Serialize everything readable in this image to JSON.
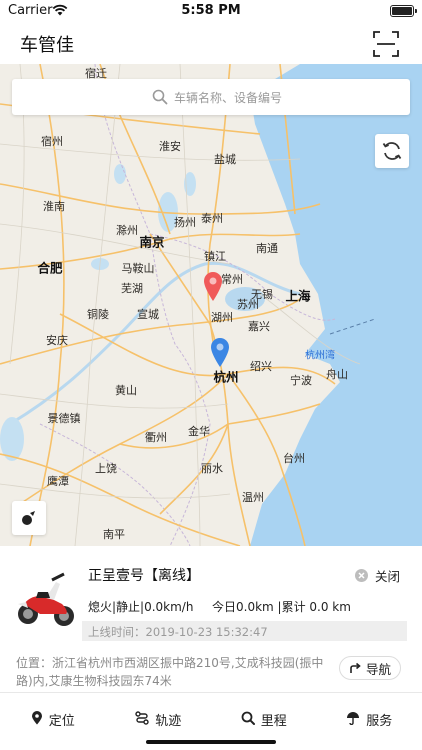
{
  "status_bar": {
    "carrier": "Carrier",
    "time": "5:58 PM"
  },
  "header": {
    "title": "车管佳",
    "scan_icon": "scan-frame-icon"
  },
  "search": {
    "placeholder": "车辆名称、设备编号",
    "icon": "search-icon"
  },
  "map": {
    "refresh_icon": "refresh-icon",
    "locate_icon": "compass-icon",
    "cities": [
      {
        "name": "宿迁",
        "major": false
      },
      {
        "name": "宿州",
        "major": false
      },
      {
        "name": "淮安",
        "major": false
      },
      {
        "name": "盐城",
        "major": false
      },
      {
        "name": "淮南",
        "major": false
      },
      {
        "name": "滁州",
        "major": false
      },
      {
        "name": "扬州",
        "major": false
      },
      {
        "name": "泰州",
        "major": false
      },
      {
        "name": "南京",
        "major": true
      },
      {
        "name": "镇江",
        "major": false
      },
      {
        "name": "南通",
        "major": false
      },
      {
        "name": "合肥",
        "major": true
      },
      {
        "name": "马鞍山",
        "major": false
      },
      {
        "name": "常州",
        "major": false
      },
      {
        "name": "芜湖",
        "major": false
      },
      {
        "name": "无锡",
        "major": false
      },
      {
        "name": "苏州",
        "major": false
      },
      {
        "name": "上海",
        "major": true
      },
      {
        "name": "铜陵",
        "major": false
      },
      {
        "name": "宣城",
        "major": false
      },
      {
        "name": "湖州",
        "major": false
      },
      {
        "name": "嘉兴",
        "major": false
      },
      {
        "name": "安庆",
        "major": false
      },
      {
        "name": "杭州湾",
        "major": false
      },
      {
        "name": "杭州",
        "major": true
      },
      {
        "name": "舟山",
        "major": false
      },
      {
        "name": "黄山",
        "major": false
      },
      {
        "name": "绍兴",
        "major": false
      },
      {
        "name": "宁波",
        "major": false
      },
      {
        "name": "景德镇",
        "major": false
      },
      {
        "name": "衢州",
        "major": false
      },
      {
        "name": "金华",
        "major": false
      },
      {
        "name": "台州",
        "major": false
      },
      {
        "name": "上饶",
        "major": false
      },
      {
        "name": "丽水",
        "major": false
      },
      {
        "name": "鹰潭",
        "major": false
      },
      {
        "name": "温州",
        "major": false
      },
      {
        "name": "南平",
        "major": false
      }
    ],
    "markers": [
      {
        "type": "red-pin"
      },
      {
        "type": "blue-pin"
      }
    ]
  },
  "vehicle": {
    "name": "正呈壹号【离线】",
    "close_label": "关闭",
    "status": "熄火|静止|0.0km/h",
    "mileage": "今日0.0km |累计 0.0 km",
    "online_time": "上线时间：2019-10-23 15:32:47",
    "address": "位置：浙江省杭州市西湖区振中路210号,艾成科技园(振中路)内,艾康生物科技园东74米",
    "navigate_label": "导航"
  },
  "tabs": [
    {
      "label": "定位",
      "icon": "location-pin-icon"
    },
    {
      "label": "轨迹",
      "icon": "track-route-icon"
    },
    {
      "label": "里程",
      "icon": "search-icon"
    },
    {
      "label": "服务",
      "icon": "umbrella-icon"
    }
  ],
  "colors": {
    "land": "#f1eee7",
    "sea": "#a9d3f2",
    "road": "#f6c16a",
    "red_pin": "#f05a5a",
    "blue_pin": "#3b86e4"
  }
}
